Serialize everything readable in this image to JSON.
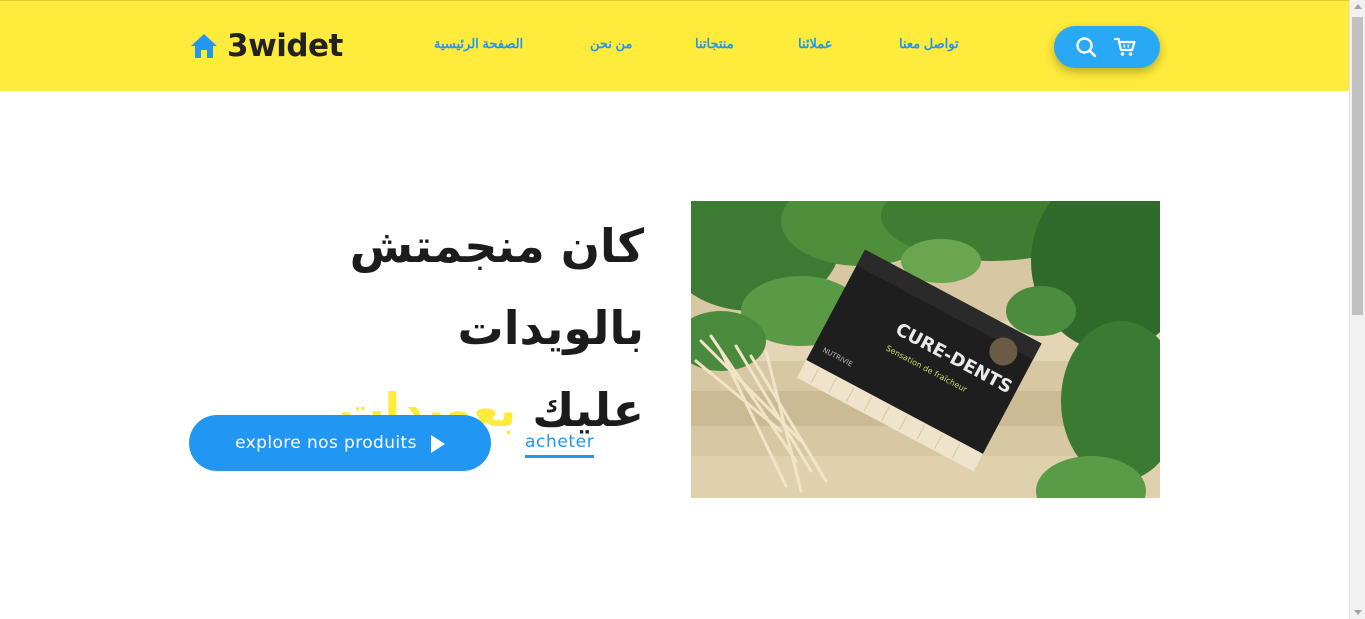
{
  "brand": {
    "name": "3widet",
    "icon": "home-icon"
  },
  "nav": {
    "items": [
      {
        "label": "الصفحة الرئيسية"
      },
      {
        "label": "من نحن"
      },
      {
        "label": "منتجاتنا"
      },
      {
        "label": "عملائنا"
      },
      {
        "label": "تواصل معنا"
      }
    ]
  },
  "header_actions": {
    "search_icon": "search-icon",
    "cart_icon": "cart-icon"
  },
  "hero": {
    "title_line1": "كان منجمتش بالويدات",
    "title_line2_dark": "عليك",
    "title_line2_highlight": "بعويدات",
    "primary_button": "explore nos produits",
    "secondary_link": "acheter"
  },
  "product_image": {
    "brand_text": "CURE-DENTS",
    "sub_text": "Sensation de fraîcheur",
    "maker": "NUTRIVIE"
  },
  "colors": {
    "header_bg": "#ffeb3b",
    "accent": "#2196f3",
    "highlight": "#ffeb3b",
    "text": "#1c1c1c"
  }
}
